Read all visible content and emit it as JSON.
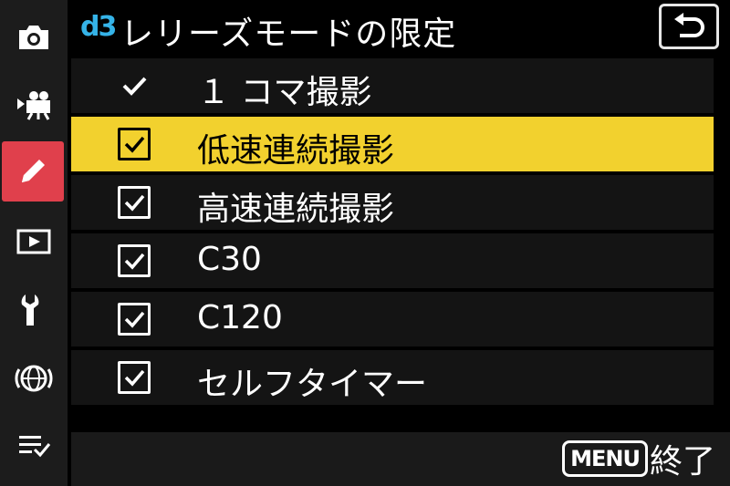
{
  "header": {
    "code": "d3",
    "title": "レリーズモードの限定"
  },
  "sidebar": {
    "items": [
      {
        "icon": "camera-icon"
      },
      {
        "icon": "movie-camera-icon"
      },
      {
        "icon": "pencil-icon",
        "active": true
      },
      {
        "icon": "playback-icon"
      },
      {
        "icon": "wrench-icon"
      },
      {
        "icon": "network-icon"
      },
      {
        "icon": "my-menu-icon"
      }
    ]
  },
  "options": [
    {
      "label": "１ コマ撮影",
      "check": "tick"
    },
    {
      "label": "低速連続撮影",
      "check": "checkbox",
      "checked": true,
      "selected": true
    },
    {
      "label": "高速連続撮影",
      "check": "checkbox",
      "checked": true
    },
    {
      "label": "C30",
      "check": "checkbox",
      "checked": true
    },
    {
      "label": "C120",
      "check": "checkbox",
      "checked": true
    },
    {
      "label": "セルフタイマー",
      "check": "checkbox",
      "checked": true
    }
  ],
  "footer": {
    "menu_badge": "MENU",
    "menu_label": "終了"
  },
  "colors": {
    "highlight": "#f2d12e",
    "accent": "#35b3e8",
    "active_tab": "#e0404c"
  }
}
